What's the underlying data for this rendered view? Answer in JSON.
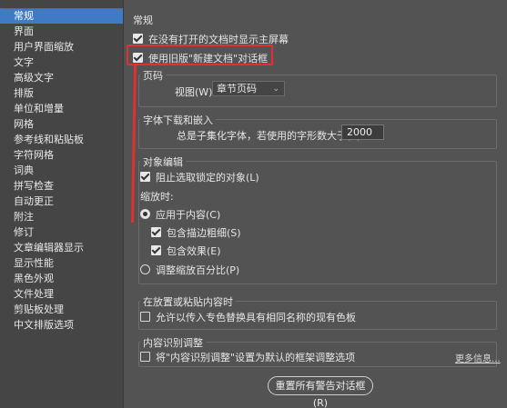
{
  "sidebar": {
    "items": [
      "常规",
      "界面",
      "用户界面缩放",
      "文字",
      "高级文字",
      "排版",
      "单位和增量",
      "网格",
      "参考线和粘贴板",
      "字符网格",
      "词典",
      "拼写检查",
      "自动更正",
      "附注",
      "修订",
      "文章编辑器显示",
      "显示性能",
      "黑色外观",
      "文件处理",
      "剪贴板处理",
      "中文排版选项"
    ],
    "selected": "常规"
  },
  "general": {
    "heading": "常规",
    "show_home_screen": "在没有打开的文档时显示主屏幕",
    "use_legacy_new_doc": "使用旧版\"新建文档\"对话框"
  },
  "page_numbers": {
    "title": "页码",
    "view_label": "视图(W):",
    "view_value": "章节页码"
  },
  "font_download": {
    "title": "字体下载和嵌入",
    "subset_label": "总是子集化字体，若使用的字形数大于(Y):",
    "subset_value": "2000"
  },
  "object_editing": {
    "title": "对象编辑",
    "prevent_locked": "阻止选取锁定的对象(L)",
    "scale_label": "缩放时:",
    "apply_to_content": "应用于内容(C)",
    "include_stroke": "包含描边粗细(S)",
    "include_effects": "包含效果(E)",
    "adjust_percent": "调整缩放百分比(P)"
  },
  "placing": {
    "title": "在放置或粘贴内容时",
    "allow_spot_replace": "允许以传入专色替换具有相同名称的现有色板"
  },
  "content_aware": {
    "title": "内容识别调整",
    "default_option": "将\"内容识别调整\"设置为默认的框架调整选项",
    "more_info": "更多信息..."
  },
  "reset_button": "重置所有警告对话框(R)",
  "colors": {
    "accent": "#3f7bc4",
    "highlight": "#e03030",
    "panel": "#535353",
    "sidebar": "#454545"
  }
}
